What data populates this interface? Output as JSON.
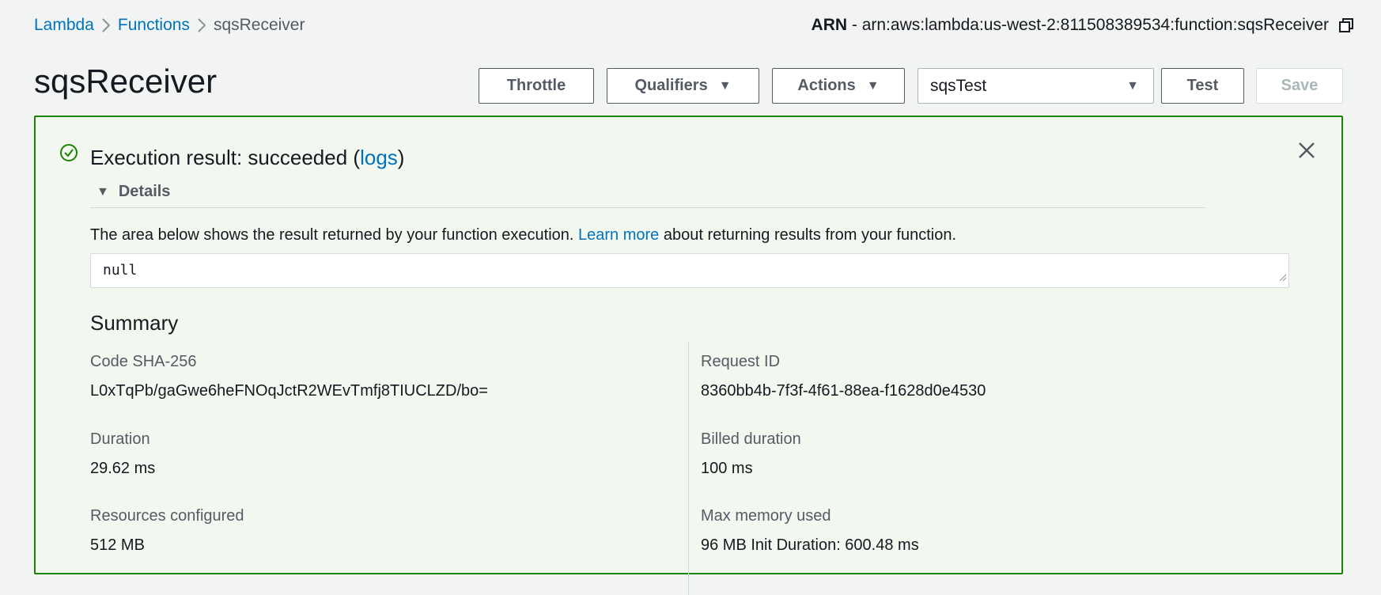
{
  "breadcrumb": {
    "items": [
      "Lambda",
      "Functions"
    ],
    "current": "sqsReceiver"
  },
  "arn": {
    "label": "ARN",
    "separator": " - ",
    "value": "arn:aws:lambda:us-west-2:811508389534:function:sqsReceiver",
    "copy_icon": "copy-icon"
  },
  "page_title": "sqsReceiver",
  "toolbar": {
    "throttle_label": "Throttle",
    "qualifiers_label": "Qualifiers",
    "actions_label": "Actions",
    "test_event_selected": "sqsTest",
    "test_label": "Test",
    "save_label": "Save"
  },
  "result": {
    "title_prefix": "Execution result: succeeded (",
    "logs_link": "logs",
    "title_suffix": ")",
    "status_icon": "check-circle-icon",
    "details_label": "Details",
    "description_prefix": "The area below shows the result returned by your function execution. ",
    "learn_more": "Learn more",
    "description_suffix": " about returning results from your function.",
    "output_value": "null"
  },
  "summary": {
    "title": "Summary",
    "code_sha_label": "Code SHA-256",
    "code_sha_value": "L0xTqPb/gaGwe6heFNOqJctR2WEvTmfj8TIUCLZD/bo=",
    "request_id_label": "Request ID",
    "request_id_value": "8360bb4b-7f3f-4f61-88ea-f1628d0e4530",
    "duration_label": "Duration",
    "duration_value": "29.62 ms",
    "billed_label": "Billed duration",
    "billed_value": "100 ms",
    "resources_label": "Resources configured",
    "resources_value": "512 MB",
    "max_memory_label": "Max memory used",
    "max_memory_value": "96 MB Init Duration: 600.48 ms"
  },
  "colors": {
    "success": "#1d8102",
    "link": "#0073bb",
    "panel_bg": "#f2f8f0"
  }
}
